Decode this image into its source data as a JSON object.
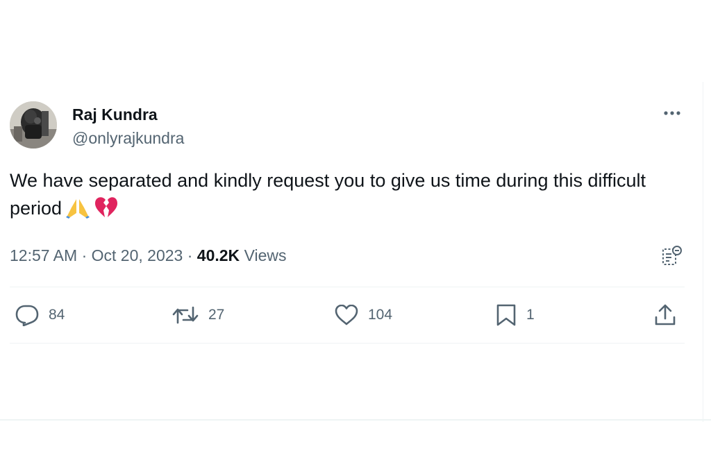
{
  "tweet": {
    "author": {
      "display_name": "Raj Kundra",
      "handle": "@onlyrajkundra"
    },
    "text": "We have separated and kindly request you to give us time during this difficult period",
    "emojis": [
      "folded-hands",
      "broken-heart"
    ],
    "meta": {
      "time": "12:57 AM",
      "separator": "·",
      "date": "Oct 20, 2023",
      "views_count": "40.2K",
      "views_label": "Views"
    },
    "actions": {
      "replies": "84",
      "reposts": "27",
      "likes": "104",
      "bookmarks": "1"
    }
  },
  "icons": {
    "more": "more-horizontal-icon",
    "notes": "community-notes-icon",
    "reply": "reply-icon",
    "retweet": "retweet-icon",
    "like": "heart-icon",
    "bookmark": "bookmark-icon",
    "share": "share-icon"
  },
  "colors": {
    "text_primary": "#0f1419",
    "text_secondary": "#536471",
    "divider": "#eff3f4",
    "broken_heart": "#e0245e",
    "folded_hands": "#f7c341"
  }
}
